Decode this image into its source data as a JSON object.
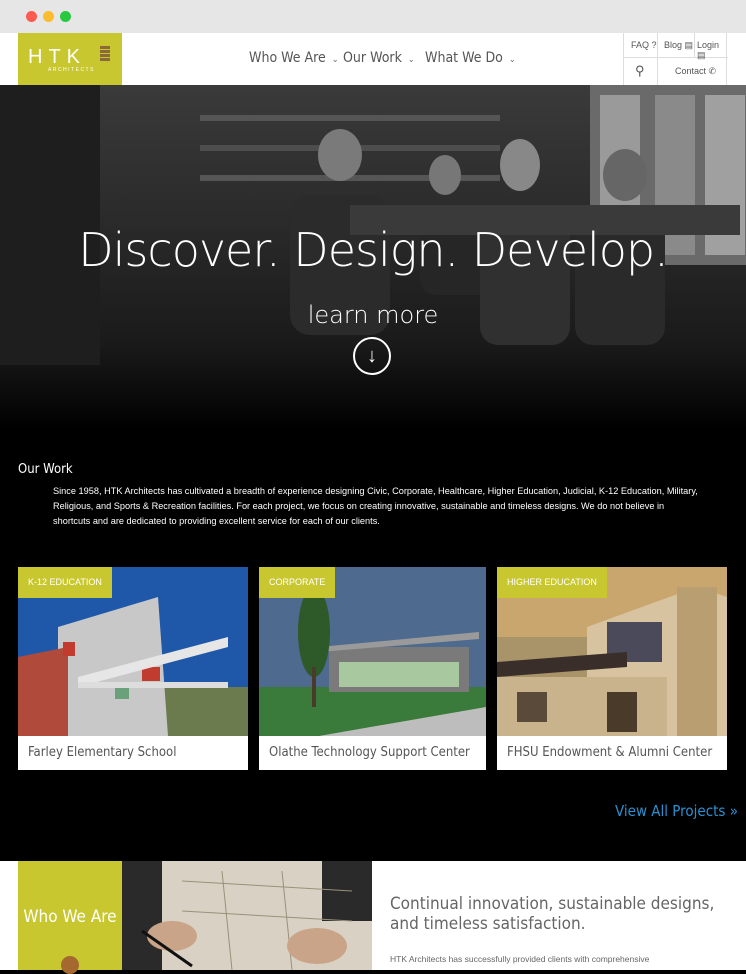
{
  "header": {
    "logo_text": "HTK",
    "logo_sub": "ARCHITECTS",
    "nav": [
      {
        "label": "Who We Are"
      },
      {
        "label": "Our Work"
      },
      {
        "label": "What We Do"
      }
    ],
    "faq": "FAQ",
    "blog": "Blog",
    "login": "Login",
    "contact": "Contact"
  },
  "hero": {
    "title": "Discover. Design. Develop.",
    "learn_more": "learn more"
  },
  "our_work": {
    "title": "Our Work",
    "description": "Since 1958, HTK Architects has cultivated a breadth of experience designing Civic, Corporate, Healthcare, Higher Education, Judicial, K-12 Education, Military, Religious, and Sports & Recreation facilities. For each project, we focus on creating innovative, sustainable and timeless designs. We do not believe in shortcuts and are dedicated to providing excellent service for each of our clients.",
    "projects": [
      {
        "category": "K-12 EDUCATION",
        "name": "Farley Elementary School"
      },
      {
        "category": "CORPORATE",
        "name": "Olathe Technology Support Center"
      },
      {
        "category": "HIGHER EDUCATION",
        "name": "FHSU Endowment & Alumni Center"
      }
    ],
    "view_all": "View All Projects »"
  },
  "who_we_are": {
    "label": "Who We Are",
    "heading": "Continual innovation, sustainable designs, and timeless satisfaction.",
    "text": "HTK Architects has successfully provided clients with comprehensive"
  },
  "colors": {
    "brand": "#c9c72f",
    "link": "#2a8fd1",
    "background": "#000000"
  }
}
